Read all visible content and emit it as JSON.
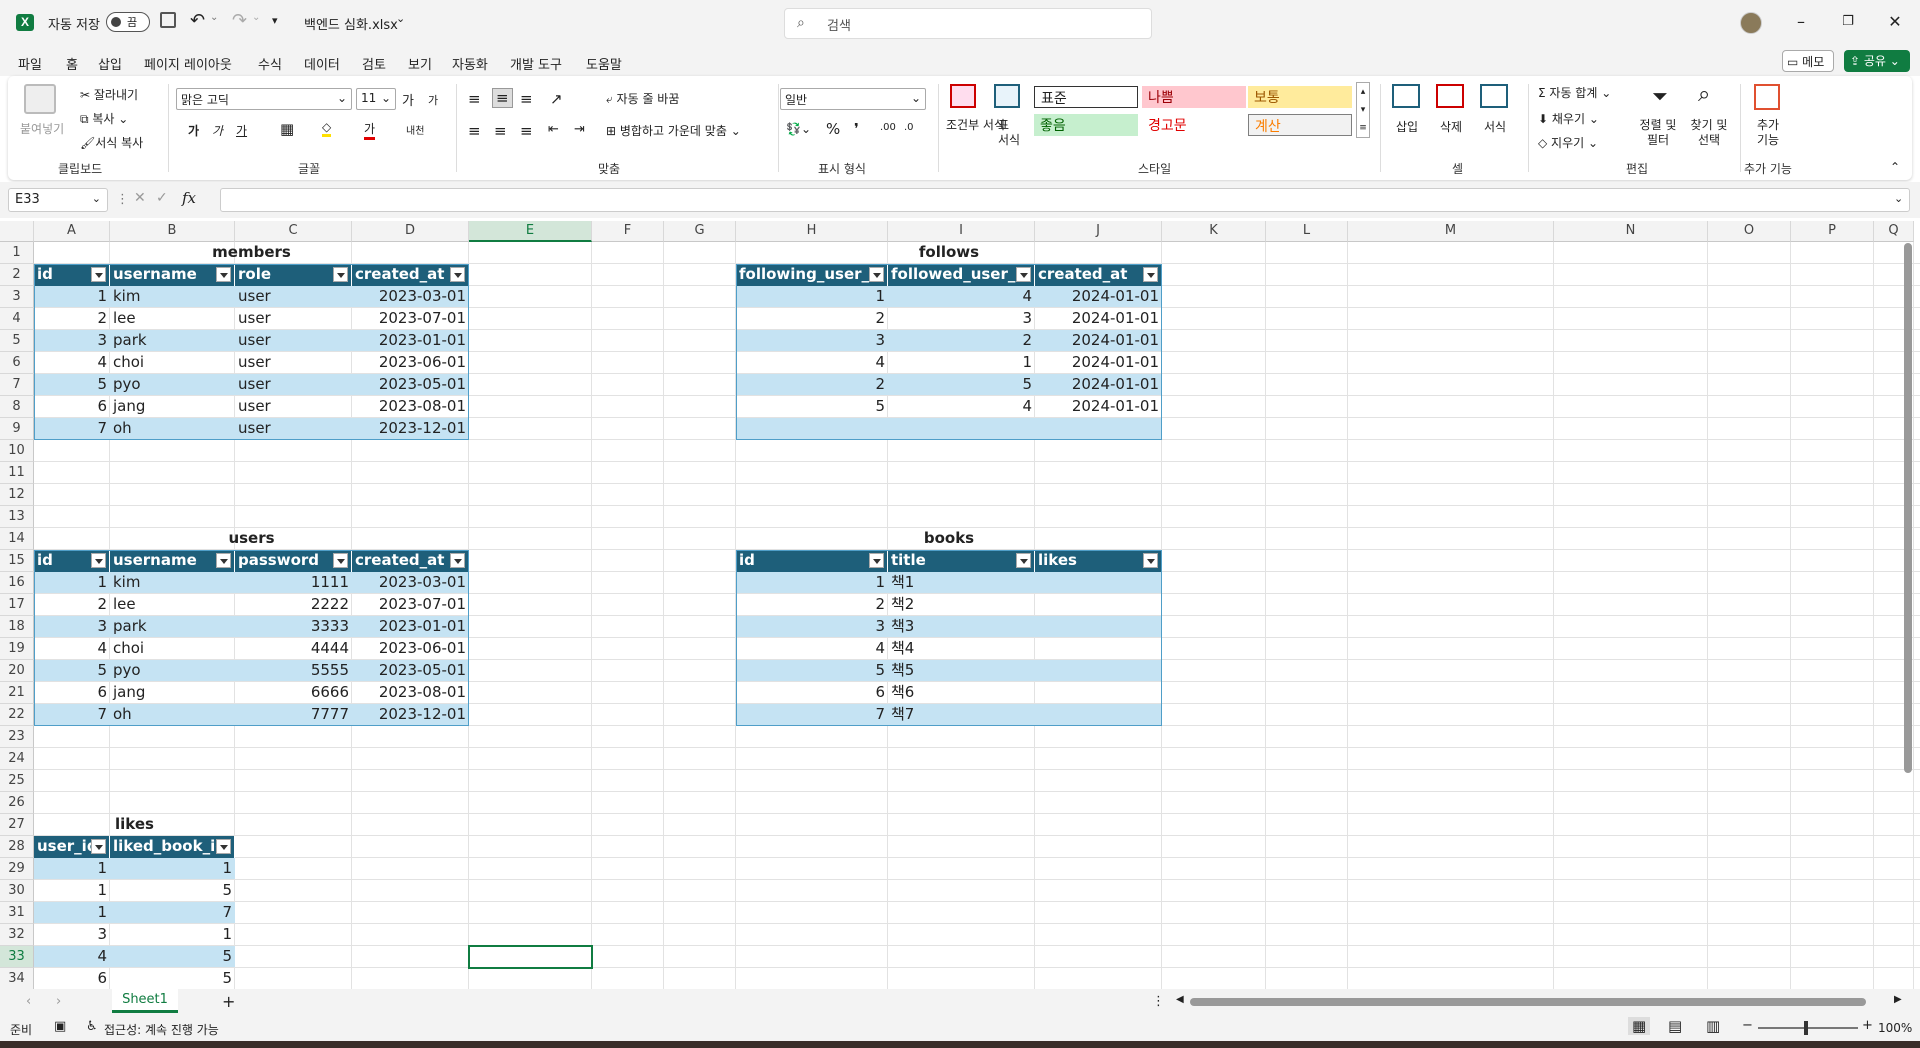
{
  "app": {
    "autosave_label": "자동 저장",
    "autosave_state": "끔",
    "filename": "백엔드 심화.xlsx",
    "search_placeholder": "검색"
  },
  "menu": [
    "파일",
    "홈",
    "삽입",
    "페이지 레이아웃",
    "수식",
    "데이터",
    "검토",
    "보기",
    "자동화",
    "개발 도구",
    "도움말"
  ],
  "menu_active": "홈",
  "right_buttons": {
    "memo": "메모",
    "share": "공유"
  },
  "ribbon": {
    "clipboard": {
      "paste": "붙여넣기",
      "cut": "잘라내기",
      "copy": "복사",
      "format_painter": "서식 복사",
      "group": "클립보드"
    },
    "font": {
      "name": "맑은 고딕",
      "size": "11",
      "group": "글꼴",
      "grow": "가",
      "shrink": "가",
      "bold": "가",
      "italic": "가",
      "underline": "가"
    },
    "align": {
      "wrap": "자동 줄 바꿈",
      "merge": "병합하고 가운데 맞춤",
      "group": "맞춤"
    },
    "number": {
      "format": "일반",
      "group": "표시 형식"
    },
    "styles": {
      "conditional": "조건부 서식",
      "table": "표 서식",
      "normal": "표준",
      "bad": "나쁨",
      "neutral": "보통",
      "good": "좋음",
      "warning": "경고문",
      "calc": "계산",
      "group": "스타일"
    },
    "cells": {
      "insert": "삽입",
      "delete": "삭제",
      "format": "서식",
      "group": "셀"
    },
    "editing": {
      "autosum": "자동 합계",
      "fill": "채우기",
      "clear": "지우기",
      "sort": "정렬 및 필터",
      "find": "찾기 및 선택",
      "group": "편집"
    },
    "addins": {
      "label": "추가 기능",
      "group": "추가 기능"
    }
  },
  "namebox": "E33",
  "columns": [
    "A",
    "B",
    "C",
    "D",
    "E",
    "F",
    "G",
    "H",
    "I",
    "J",
    "K",
    "L",
    "M",
    "N",
    "O",
    "P",
    "Q"
  ],
  "rows": [
    "1",
    "2",
    "3",
    "4",
    "5",
    "6",
    "7",
    "8",
    "9",
    "10",
    "11",
    "12",
    "13",
    "14",
    "15",
    "16",
    "17",
    "18",
    "19",
    "20",
    "21",
    "22",
    "23",
    "24",
    "25",
    "26",
    "27",
    "28",
    "29",
    "30",
    "31",
    "32",
    "33",
    "34"
  ],
  "tables": {
    "members": {
      "title": "members",
      "headers": [
        "id",
        "username",
        "role",
        "created_at"
      ],
      "rows": [
        [
          "1",
          "kim",
          "user",
          "2023-03-01"
        ],
        [
          "2",
          "lee",
          "user",
          "2023-07-01"
        ],
        [
          "3",
          "park",
          "user",
          "2023-01-01"
        ],
        [
          "4",
          "choi",
          "user",
          "2023-06-01"
        ],
        [
          "5",
          "pyo",
          "user",
          "2023-05-01"
        ],
        [
          "6",
          "jang",
          "user",
          "2023-08-01"
        ],
        [
          "7",
          "oh",
          "user",
          "2023-12-01"
        ]
      ]
    },
    "follows": {
      "title": "follows",
      "headers": [
        "following_user_id",
        "followed_user_id",
        "created_at"
      ],
      "rows": [
        [
          "1",
          "4",
          "2024-01-01"
        ],
        [
          "2",
          "3",
          "2024-01-01"
        ],
        [
          "3",
          "2",
          "2024-01-01"
        ],
        [
          "4",
          "1",
          "2024-01-01"
        ],
        [
          "2",
          "5",
          "2024-01-01"
        ],
        [
          "5",
          "4",
          "2024-01-01"
        ]
      ]
    },
    "users": {
      "title": "users",
      "headers": [
        "id",
        "username",
        "password",
        "created_at"
      ],
      "rows": [
        [
          "1",
          "kim",
          "1111",
          "2023-03-01"
        ],
        [
          "2",
          "lee",
          "2222",
          "2023-07-01"
        ],
        [
          "3",
          "park",
          "3333",
          "2023-01-01"
        ],
        [
          "4",
          "choi",
          "4444",
          "2023-06-01"
        ],
        [
          "5",
          "pyo",
          "5555",
          "2023-05-01"
        ],
        [
          "6",
          "jang",
          "6666",
          "2023-08-01"
        ],
        [
          "7",
          "oh",
          "7777",
          "2023-12-01"
        ]
      ]
    },
    "books": {
      "title": "books",
      "headers": [
        "id",
        "title",
        "likes"
      ],
      "rows": [
        [
          "1",
          "책1",
          ""
        ],
        [
          "2",
          "책2",
          ""
        ],
        [
          "3",
          "책3",
          ""
        ],
        [
          "4",
          "책4",
          ""
        ],
        [
          "5",
          "책5",
          ""
        ],
        [
          "6",
          "책6",
          ""
        ],
        [
          "7",
          "책7",
          ""
        ]
      ]
    },
    "likes": {
      "title": "likes",
      "headers": [
        "user_id",
        "liked_book_id"
      ],
      "rows": [
        [
          "1",
          "1"
        ],
        [
          "1",
          "5"
        ],
        [
          "1",
          "7"
        ],
        [
          "3",
          "1"
        ],
        [
          "4",
          "5"
        ],
        [
          "6",
          "5"
        ]
      ]
    }
  },
  "sheet_tab": "Sheet1",
  "status": {
    "ready": "준비",
    "accessibility": "접근성: 계속 진행 가능",
    "zoom": "100%"
  },
  "colors": {
    "excel_green": "#107c41",
    "table_header": "#1e5f7a",
    "band": "#c5e3f3"
  }
}
